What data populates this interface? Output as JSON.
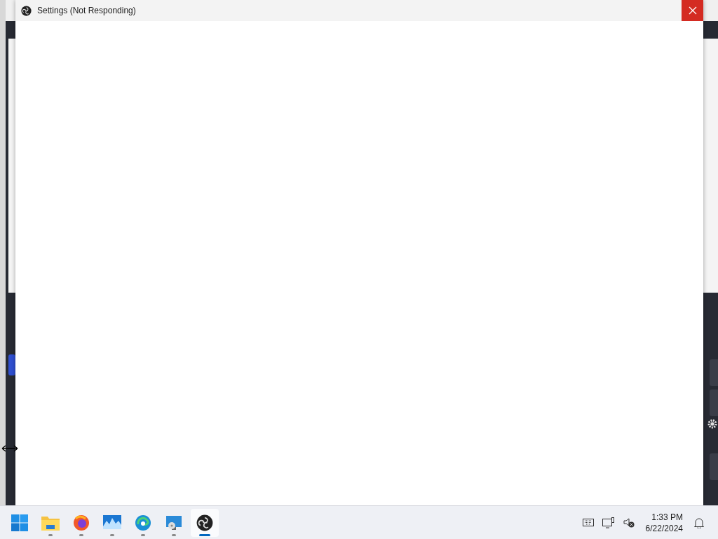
{
  "window": {
    "title": "Settings (Not Responding)"
  },
  "taskbar": {
    "apps": [
      {
        "kind": "start",
        "running": false,
        "selected": false
      },
      {
        "kind": "folder",
        "running": true,
        "selected": false
      },
      {
        "kind": "browser",
        "running": true,
        "selected": false
      },
      {
        "kind": "monitor",
        "running": true,
        "selected": false
      },
      {
        "kind": "edge",
        "running": true,
        "selected": false
      },
      {
        "kind": "remote",
        "running": true,
        "selected": false
      },
      {
        "kind": "recorder",
        "running": true,
        "selected": true
      }
    ],
    "clock": {
      "time": "1:33 PM",
      "date": "6/22/2024"
    }
  }
}
